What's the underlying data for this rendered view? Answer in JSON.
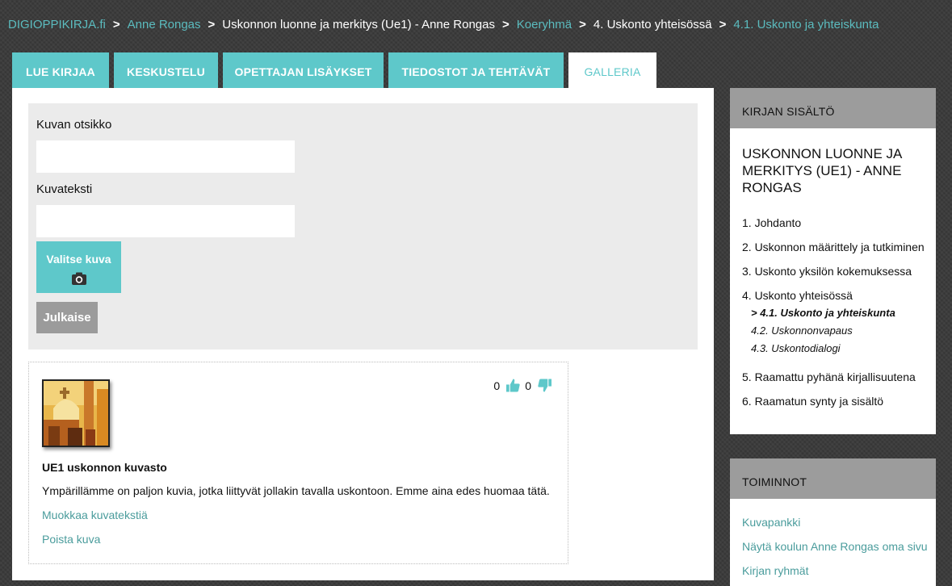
{
  "breadcrumb": {
    "brand": "DIGIOPPIKIRJA.fi",
    "sep": ">",
    "items": [
      "Anne Rongas",
      "Uskonnon luonne ja merkitys (Ue1) - Anne Rongas",
      "Koeryhmä",
      "4. Uskonto yhteisössä",
      "4.1. Uskonto ja yhteiskunta"
    ]
  },
  "tabs": [
    {
      "label": "LUE KIRJAA"
    },
    {
      "label": "KESKUSTELU"
    },
    {
      "label": "OPETTAJAN LISÄYKSET"
    },
    {
      "label": "TIEDOSTOT JA TEHTÄVÄT"
    },
    {
      "label": "GALLERIA",
      "active": true
    }
  ],
  "form": {
    "title_label": "Kuvan otsikko",
    "title_value": "",
    "caption_label": "Kuvateksti",
    "caption_value": "",
    "choose_label": "Valitse kuva",
    "choose_icon": "camera-icon",
    "publish_label": "Julkaise"
  },
  "gallery_item": {
    "likes": "0",
    "dislikes": "0",
    "title": "UE1 uskonnon kuvasto",
    "caption": "Ympärillämme on paljon kuvia, jotka liittyvät jollakin tavalla uskontoon. Emme aina edes huomaa tätä.",
    "edit_link": "Muokkaa kuvatekstiä",
    "delete_link": "Poista kuva"
  },
  "sidebar": {
    "contents_header": "KIRJAN SISÄLTÖ",
    "book_title": "USKONNON LUONNE JA MERKITYS (UE1) - ANNE RONGAS",
    "toc": [
      "1. Johdanto",
      "2. Uskonnon määrittely ja tutkiminen",
      "3. Uskonto yksilön kokemuksessa",
      "4. Uskonto yhteisössä",
      "5. Raamattu pyhänä kirjallisuutena",
      "6. Raamatun synty ja sisältö"
    ],
    "toc_sub": [
      "> 4.1. Uskonto ja yhteiskunta",
      "4.2. Uskonnonvapaus",
      "4.3. Uskontodialogi"
    ],
    "actions_header": "TOIMINNOT",
    "actions": [
      "Kuvapankki",
      "Näytä koulun Anne Rongas oma sivu",
      "Kirjan ryhmät"
    ]
  },
  "colors": {
    "accent": "#5ec8ca",
    "link": "#4a9c9c",
    "background": "#3a3a3a",
    "panel_header": "#9c9c9c"
  }
}
